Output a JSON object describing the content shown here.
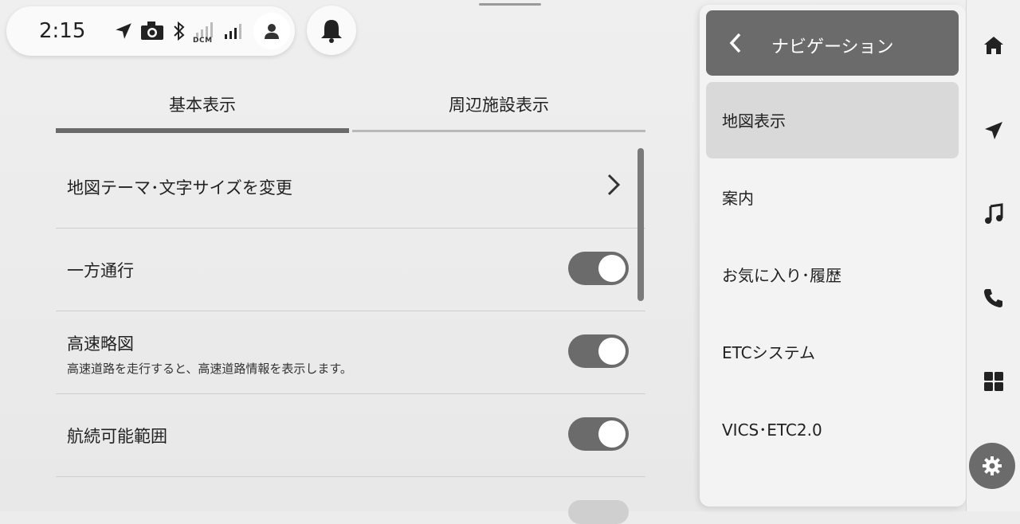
{
  "status_bar": {
    "time": "2:15",
    "icons": [
      "navigation-arrow-icon",
      "camera-icon",
      "bluetooth-icon",
      "dcm-signal-icon",
      "cellular-signal-icon",
      "user-icon"
    ],
    "dcm_label": "DCM"
  },
  "tabs": [
    {
      "label": "基本表示",
      "active": true
    },
    {
      "label": "周辺施設表示",
      "active": false
    }
  ],
  "settings": {
    "theme_row": "地図テーマ･文字サイズを変更",
    "one_way": {
      "label": "一方通行",
      "on": true
    },
    "highway": {
      "label": "高速略図",
      "description": "高速道路を走行すると、高速道路情報を表示します。",
      "on": true
    },
    "range": {
      "label": "航続可能範囲",
      "on": true
    }
  },
  "side_panel": {
    "title": "ナビゲーション",
    "items": [
      {
        "label": "地図表示",
        "active": true
      },
      {
        "label": "案内",
        "active": false
      },
      {
        "label": "お気に入り･履歴",
        "active": false
      },
      {
        "label": "ETCシステム",
        "active": false
      },
      {
        "label": "VICS･ETC2.0",
        "active": false
      }
    ]
  },
  "rail": [
    "home-icon",
    "navigation-icon",
    "music-icon",
    "phone-icon",
    "apps-grid-icon",
    "settings-gear-icon"
  ],
  "colors": {
    "accent_dark": "#6b6b6b",
    "active_item": "#d9d9d9",
    "background": "#ececec"
  }
}
